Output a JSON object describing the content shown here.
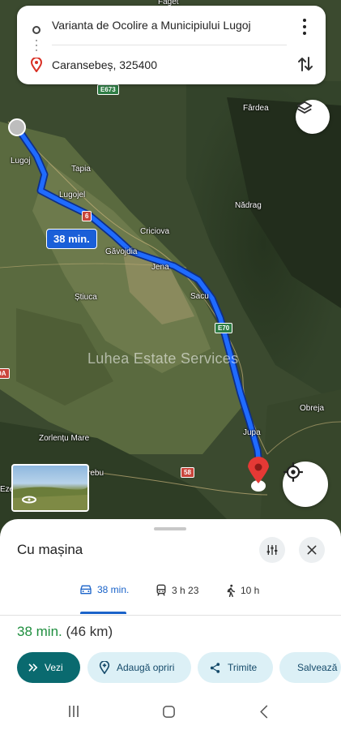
{
  "search": {
    "origin": "Varianta de Ocolire a Municipiului Lugoj",
    "destination": "Caransebeș, 325400"
  },
  "map": {
    "places": [
      "Făget",
      "Fârdea",
      "Lugoj",
      "Tapia",
      "Lugojel",
      "Nădrag",
      "Criciova",
      "Găvojdia",
      "Jena",
      "Sacu",
      "Știuca",
      "Jupa",
      "Obreja",
      "Zorlențu Mare",
      "Ezer",
      "rebu"
    ],
    "road_badges": [
      "E673",
      "6",
      "E70",
      "58",
      "DA"
    ],
    "route_time": "38 min.",
    "watermark": "Luhea Estate Services"
  },
  "sheet": {
    "title": "Cu mașina",
    "modes": [
      {
        "label": "38 min.",
        "icon": "car-icon",
        "active": true
      },
      {
        "label": "3 h 23",
        "icon": "train-icon",
        "active": false
      },
      {
        "label": "10 h",
        "icon": "walk-icon",
        "active": false
      }
    ],
    "summary_time": "38 min.",
    "summary_distance": "(46 km)",
    "chips": [
      "Vezi",
      "Adaugă opriri",
      "Trimite",
      "Salvează"
    ]
  },
  "colors": {
    "route": "#1a5fd8",
    "primary_chip": "#0a6a6f",
    "summary_green": "#1e8e3e",
    "pin": "#e53935"
  }
}
